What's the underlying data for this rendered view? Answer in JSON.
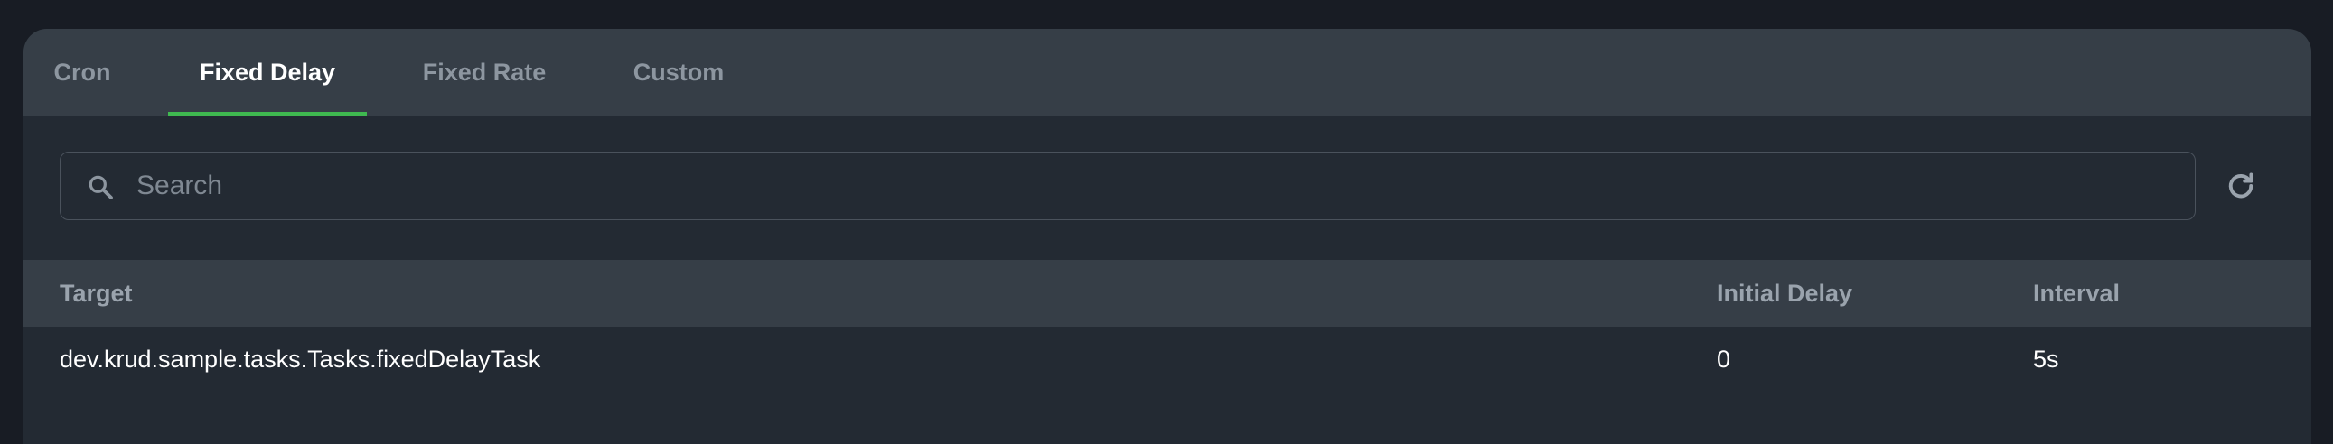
{
  "tabs": [
    {
      "label": "Cron",
      "active": false
    },
    {
      "label": "Fixed Delay",
      "active": true
    },
    {
      "label": "Fixed Rate",
      "active": false
    },
    {
      "label": "Custom",
      "active": false
    }
  ],
  "search": {
    "placeholder": "Search",
    "value": "",
    "icon": "search-icon"
  },
  "refresh": {
    "icon": "refresh-icon"
  },
  "table": {
    "columns": [
      "Target",
      "Initial Delay",
      "Interval"
    ],
    "rows": [
      {
        "target": "dev.krud.sample.tasks.Tasks.fixedDelayTask",
        "initial_delay": "0",
        "interval": "5s"
      }
    ]
  },
  "colors": {
    "accent": "#3fb950",
    "background": "#181c24",
    "panel": "#232a33",
    "header": "#363e47"
  }
}
